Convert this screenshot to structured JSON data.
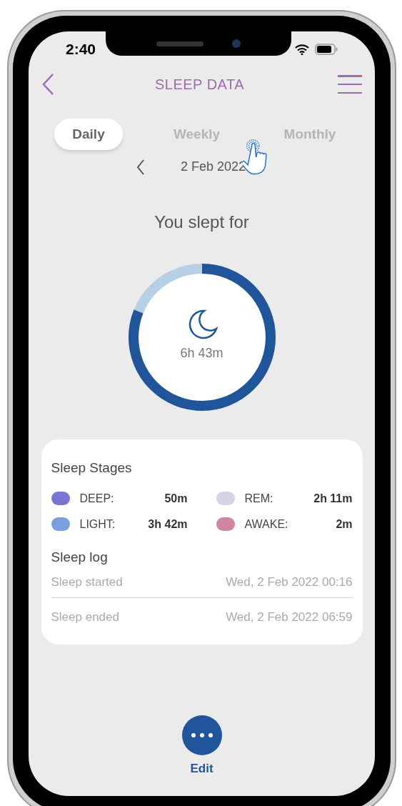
{
  "status_bar": {
    "time": "2:40"
  },
  "header": {
    "title": "SLEEP DATA"
  },
  "tabs": [
    {
      "label": "Daily",
      "selected": true
    },
    {
      "label": "Weekly",
      "selected": false
    },
    {
      "label": "Monthly",
      "selected": false
    }
  ],
  "date": "2 Feb 2022",
  "summary": {
    "heading": "You slept for",
    "duration": "6h 43m"
  },
  "sleep_stages": {
    "title": "Sleep Stages",
    "items": [
      {
        "label": "DEEP:",
        "value": "50m",
        "color": "#7b74d2"
      },
      {
        "label": "REM:",
        "value": "2h 11m",
        "color": "#d4d3e8"
      },
      {
        "label": "LIGHT:",
        "value": "3h 42m",
        "color": "#7a9fdc"
      },
      {
        "label": "AWAKE:",
        "value": "2m",
        "color": "#cf86a2"
      }
    ]
  },
  "sleep_log": {
    "title": "Sleep log",
    "rows": [
      {
        "label": "Sleep started",
        "value": "Wed, 2 Feb 2022 00:16"
      },
      {
        "label": "Sleep ended",
        "value": "Wed, 2 Feb 2022 06:59"
      }
    ]
  },
  "edit_button": {
    "label": "Edit"
  }
}
